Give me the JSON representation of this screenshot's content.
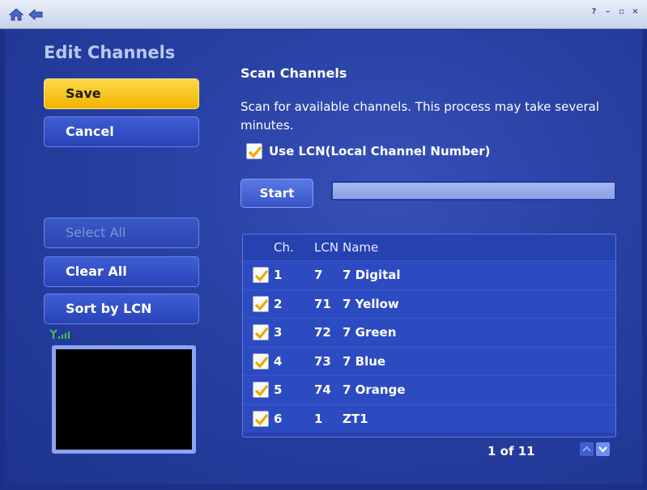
{
  "window": {
    "controls": [
      "?",
      "–",
      "▫",
      "×"
    ]
  },
  "sidebar": {
    "title": "Edit Channels",
    "save_label": "Save",
    "cancel_label": "Cancel",
    "select_all_label": "Select All",
    "clear_all_label": "Clear All",
    "sort_label": "Sort by LCN"
  },
  "scan": {
    "title": "Scan Channels",
    "description": "Scan for available channels. This process may take several minutes.",
    "use_lcn_label": "Use LCN(Local Channel Number)",
    "use_lcn_checked": true,
    "start_label": "Start",
    "progress": 1.0
  },
  "table": {
    "headers": {
      "ch": "Ch.",
      "lcn": "LCN",
      "name": "Name"
    },
    "rows": [
      {
        "checked": true,
        "ch": "1",
        "lcn": "7",
        "name": "7 Digital"
      },
      {
        "checked": true,
        "ch": "2",
        "lcn": "71",
        "name": "7 Yellow"
      },
      {
        "checked": true,
        "ch": "3",
        "lcn": "72",
        "name": "7 Green"
      },
      {
        "checked": true,
        "ch": "4",
        "lcn": "73",
        "name": "7 Blue"
      },
      {
        "checked": true,
        "ch": "5",
        "lcn": "74",
        "name": "7 Orange"
      },
      {
        "checked": true,
        "ch": "6",
        "lcn": "1",
        "name": "ZT1"
      }
    ]
  },
  "pager": {
    "text": "1 of 11"
  },
  "colors": {
    "accent": "#f2b400",
    "check": "#f0a800",
    "panel": "#2740a2"
  }
}
